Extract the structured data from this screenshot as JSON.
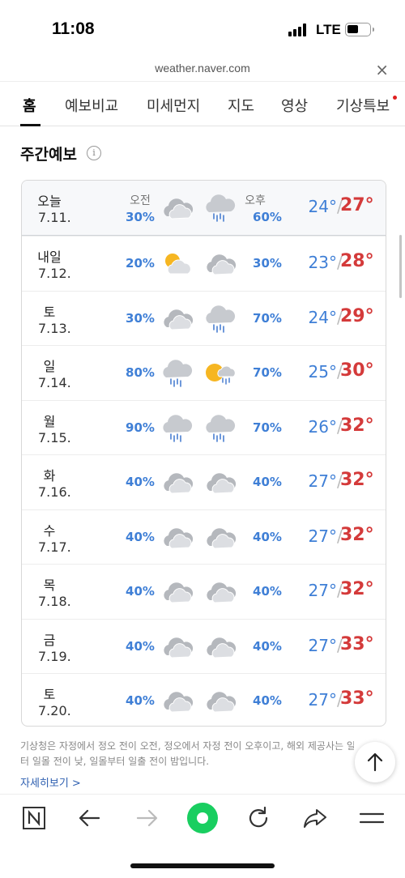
{
  "status_bar": {
    "time": "11:08",
    "network": "LTE"
  },
  "browser": {
    "url": "weather.naver.com",
    "close_glyph": "×"
  },
  "tabs": [
    {
      "label": "홈",
      "active": true
    },
    {
      "label": "예보비교"
    },
    {
      "label": "미세먼지"
    },
    {
      "label": "지도"
    },
    {
      "label": "영상"
    },
    {
      "label": "기상특보",
      "badge": "new-dot"
    }
  ],
  "section": {
    "title": "주간예보",
    "info_glyph": "i"
  },
  "forecast": [
    {
      "day": "오늘",
      "date": "7.11.",
      "am_label": "오전",
      "pm_label": "오후",
      "am_pct": "30%",
      "pm_pct": "60%",
      "am_icon": "cloudy-icon",
      "pm_icon": "rain-icon",
      "low": "24°",
      "high": "27°"
    },
    {
      "day": "내일",
      "date": "7.12.",
      "am_pct": "20%",
      "pm_pct": "30%",
      "am_icon": "partly-sunny-icon",
      "pm_icon": "cloudy-icon",
      "low": "23°",
      "high": "28°"
    },
    {
      "day": "토",
      "date": "7.13.",
      "am_pct": "30%",
      "pm_pct": "70%",
      "am_icon": "cloudy-icon",
      "pm_icon": "rain-icon",
      "low": "24°",
      "high": "29°"
    },
    {
      "day": "일",
      "date": "7.14.",
      "am_pct": "80%",
      "pm_pct": "70%",
      "am_icon": "rain-icon",
      "pm_icon": "sun-shower-icon",
      "low": "25°",
      "high": "30°"
    },
    {
      "day": "월",
      "date": "7.15.",
      "am_pct": "90%",
      "pm_pct": "70%",
      "am_icon": "rain-icon",
      "pm_icon": "rain-icon",
      "low": "26°",
      "high": "32°"
    },
    {
      "day": "화",
      "date": "7.16.",
      "am_pct": "40%",
      "pm_pct": "40%",
      "am_icon": "cloudy-icon",
      "pm_icon": "cloudy-icon",
      "low": "27°",
      "high": "32°"
    },
    {
      "day": "수",
      "date": "7.17.",
      "am_pct": "40%",
      "pm_pct": "40%",
      "am_icon": "cloudy-icon",
      "pm_icon": "cloudy-icon",
      "low": "27°",
      "high": "32°"
    },
    {
      "day": "목",
      "date": "7.18.",
      "am_pct": "40%",
      "pm_pct": "40%",
      "am_icon": "cloudy-icon",
      "pm_icon": "cloudy-icon",
      "low": "27°",
      "high": "32°"
    },
    {
      "day": "금",
      "date": "7.19.",
      "am_pct": "40%",
      "pm_pct": "40%",
      "am_icon": "cloudy-icon",
      "pm_icon": "cloudy-icon",
      "low": "27°",
      "high": "33°"
    },
    {
      "day": "토",
      "date": "7.20.",
      "am_pct": "40%",
      "pm_pct": "40%",
      "am_icon": "cloudy-icon",
      "pm_icon": "cloudy-icon",
      "low": "27°",
      "high": "33°"
    }
  ],
  "slash": "/",
  "footnote": {
    "line1": "기상청은 자정에서 정오 전이 오전, 정오에서 자정 전이 오후이고, 해외 제공사는 일출부",
    "line2": "터 일몰 전이 낮, 일몰부터 일출 전이 밤입니다.",
    "more_link": "자세히보기 >"
  },
  "toolbar": {
    "items": [
      "naver-n-icon",
      "back-arrow-icon",
      "forward-arrow-icon",
      "green-dot-icon",
      "refresh-icon",
      "share-icon",
      "menu-icon"
    ]
  },
  "colors": {
    "low_temp": "#3f7fd6",
    "high_temp": "#d43a3a",
    "naver_green": "#19ce60",
    "new_badge": "#e02020"
  }
}
